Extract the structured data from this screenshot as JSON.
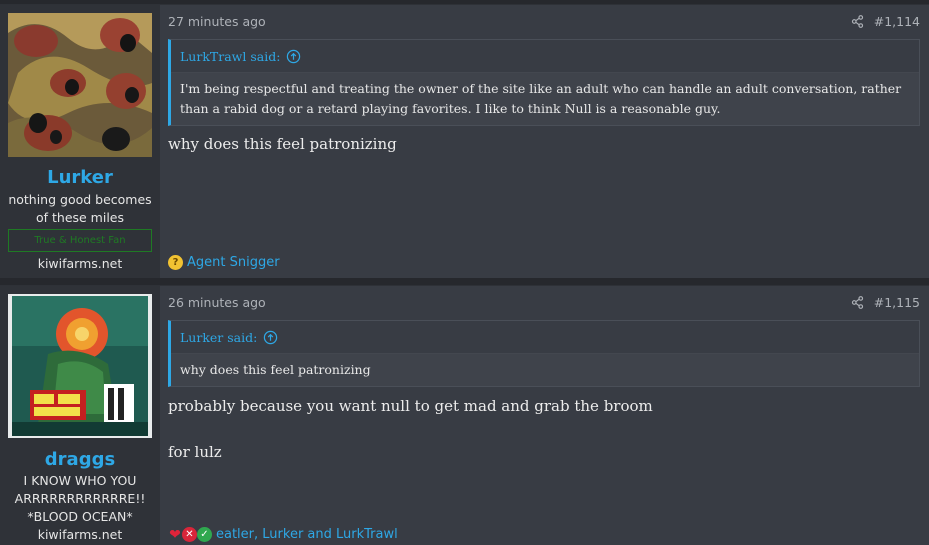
{
  "posts": [
    {
      "username": "Lurker",
      "user_title_line1": "nothing good becomes",
      "user_title_line2": "of these miles",
      "user_banner": "True & Honest Fan",
      "user_site": "kiwifarms.net",
      "time": "27 minutes ago",
      "post_number": "#1,114",
      "quote": {
        "author": "LurkTrawl said:",
        "text": "I'm being respectful and treating the owner of the site like an adult who can handle an adult conversation, rather than a rabid dog or a retard playing favorites. I like to think Null is a reasonable guy."
      },
      "message_lines": [
        "why does this feel patronizing"
      ],
      "reactions": {
        "icons": [
          "thinking-emoji"
        ],
        "text": "Agent Snigger"
      }
    },
    {
      "username": "draggs",
      "user_title_line1": "I KNOW WHO YOU",
      "user_title_line2": "ARRRRRRRRRRRRE!!",
      "user_title_line3": "*BLOOD OCEAN*",
      "user_site": "kiwifarms.net",
      "time": "26 minutes ago",
      "post_number": "#1,115",
      "quote": {
        "author": "Lurker said:",
        "text": "why does this feel patronizing"
      },
      "message_lines": [
        "probably because you want null to get mad and grab the broom",
        "for lulz"
      ],
      "reactions": {
        "icons": [
          "heart-icon",
          "x-icon",
          "check-icon"
        ],
        "text": "eatler, Lurker and LurkTrawl"
      }
    }
  ],
  "colors": {
    "accent": "#2ea8e6",
    "post_bg": "#383c44",
    "user_col_bg": "#2f3238",
    "banner_green": "#1f7a24"
  }
}
